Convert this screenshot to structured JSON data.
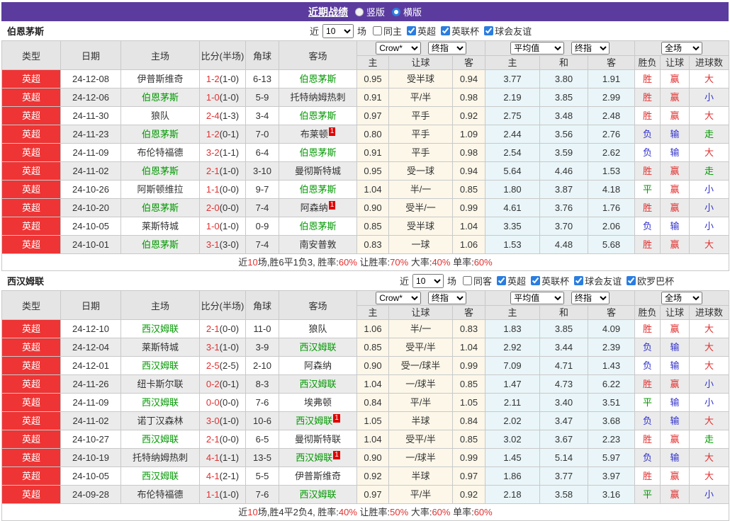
{
  "header": {
    "title": "近期战绩",
    "radio_vertical": "竖版",
    "radio_horizontal": "横版",
    "vertical_checked": false,
    "horizontal_checked": true
  },
  "labels": {
    "near": "近",
    "count": "10",
    "games": "场"
  },
  "selects": {
    "book": "Crow*",
    "final": "终指",
    "avg": "平均值",
    "full": "全场"
  },
  "columns": {
    "type": "类型",
    "date": "日期",
    "home": "主场",
    "score": "比分(半场)",
    "corner": "角球",
    "away": "客场",
    "sub": [
      "主",
      "让球",
      "客",
      "主",
      "和",
      "客",
      "胜负",
      "让球",
      "进球数"
    ]
  },
  "colors": {
    "topbar_purple": "#5b3c9e",
    "league_red": "#ee3434",
    "win_red": "#e23030",
    "lose_blue": "#3232cd",
    "draw_green": "#009900",
    "team_green": "#009900",
    "odds_bg": "#fcf7e9",
    "avg_bg": "#e9f5f9",
    "alt_row": "#ebebeb"
  },
  "sections": [
    {
      "team": "伯恩茅斯",
      "filters": [
        {
          "label": "同主",
          "checked": false
        },
        {
          "label": "英超",
          "checked": true
        },
        {
          "label": "英联杯",
          "checked": true
        },
        {
          "label": "球会友谊",
          "checked": true
        }
      ],
      "rows": [
        {
          "league": "英超",
          "date": "24-12-08",
          "home": "伊普斯维奇",
          "home_self": false,
          "home_badge": "",
          "score": "1-2",
          "half": "(1-0)",
          "corners": "6-13",
          "away": "伯恩茅斯",
          "away_self": true,
          "away_badge": "",
          "odds_home": "0.95",
          "handicap": "受半球",
          "odds_away": "0.94",
          "avg_home": "3.77",
          "avg_draw": "3.80",
          "avg_away": "1.91",
          "result": "胜",
          "result_c": "w",
          "let": "赢",
          "let_c": "w",
          "goals": "大",
          "goals_c": "w"
        },
        {
          "league": "英超",
          "date": "24-12-06",
          "home": "伯恩茅斯",
          "home_self": true,
          "home_badge": "",
          "score": "1-0",
          "half": "(1-0)",
          "corners": "5-9",
          "away": "托特纳姆热刺",
          "away_self": false,
          "away_badge": "",
          "odds_home": "0.91",
          "handicap": "平/半",
          "odds_away": "0.98",
          "avg_home": "2.19",
          "avg_draw": "3.85",
          "avg_away": "2.99",
          "result": "胜",
          "result_c": "w",
          "let": "赢",
          "let_c": "w",
          "goals": "小",
          "goals_c": "l"
        },
        {
          "league": "英超",
          "date": "24-11-30",
          "home": "狼队",
          "home_self": false,
          "home_badge": "",
          "score": "2-4",
          "half": "(1-3)",
          "corners": "3-4",
          "away": "伯恩茅斯",
          "away_self": true,
          "away_badge": "",
          "odds_home": "0.97",
          "handicap": "平手",
          "odds_away": "0.92",
          "avg_home": "2.75",
          "avg_draw": "3.48",
          "avg_away": "2.48",
          "result": "胜",
          "result_c": "w",
          "let": "赢",
          "let_c": "w",
          "goals": "大",
          "goals_c": "w"
        },
        {
          "league": "英超",
          "date": "24-11-23",
          "home": "伯恩茅斯",
          "home_self": true,
          "home_badge": "",
          "score": "1-2",
          "half": "(0-1)",
          "corners": "7-0",
          "away": "布莱顿",
          "away_self": false,
          "away_badge": "1",
          "odds_home": "0.80",
          "handicap": "平手",
          "odds_away": "1.09",
          "avg_home": "2.44",
          "avg_draw": "3.56",
          "avg_away": "2.76",
          "result": "负",
          "result_c": "l",
          "let": "输",
          "let_c": "l",
          "goals": "走",
          "goals_c": "d"
        },
        {
          "league": "英超",
          "date": "24-11-09",
          "home": "布伦特福德",
          "home_self": false,
          "home_badge": "",
          "score": "3-2",
          "half": "(1-1)",
          "corners": "6-4",
          "away": "伯恩茅斯",
          "away_self": true,
          "away_badge": "",
          "odds_home": "0.91",
          "handicap": "平手",
          "odds_away": "0.98",
          "avg_home": "2.54",
          "avg_draw": "3.59",
          "avg_away": "2.62",
          "result": "负",
          "result_c": "l",
          "let": "输",
          "let_c": "l",
          "goals": "大",
          "goals_c": "w"
        },
        {
          "league": "英超",
          "date": "24-11-02",
          "home": "伯恩茅斯",
          "home_self": true,
          "home_badge": "",
          "score": "2-1",
          "half": "(1-0)",
          "corners": "3-10",
          "away": "曼彻斯特城",
          "away_self": false,
          "away_badge": "",
          "odds_home": "0.95",
          "handicap": "受一球",
          "odds_away": "0.94",
          "avg_home": "5.64",
          "avg_draw": "4.46",
          "avg_away": "1.53",
          "result": "胜",
          "result_c": "w",
          "let": "赢",
          "let_c": "w",
          "goals": "走",
          "goals_c": "d"
        },
        {
          "league": "英超",
          "date": "24-10-26",
          "home": "阿斯顿维拉",
          "home_self": false,
          "home_badge": "",
          "score": "1-1",
          "half": "(0-0)",
          "corners": "9-7",
          "away": "伯恩茅斯",
          "away_self": true,
          "away_badge": "",
          "odds_home": "1.04",
          "handicap": "半/一",
          "odds_away": "0.85",
          "avg_home": "1.80",
          "avg_draw": "3.87",
          "avg_away": "4.18",
          "result": "平",
          "result_c": "d",
          "let": "赢",
          "let_c": "w",
          "goals": "小",
          "goals_c": "l"
        },
        {
          "league": "英超",
          "date": "24-10-20",
          "home": "伯恩茅斯",
          "home_self": true,
          "home_badge": "",
          "score": "2-0",
          "half": "(0-0)",
          "corners": "7-4",
          "away": "阿森纳",
          "away_self": false,
          "away_badge": "1",
          "odds_home": "0.90",
          "handicap": "受半/一",
          "odds_away": "0.99",
          "avg_home": "4.61",
          "avg_draw": "3.76",
          "avg_away": "1.76",
          "result": "胜",
          "result_c": "w",
          "let": "赢",
          "let_c": "w",
          "goals": "小",
          "goals_c": "l"
        },
        {
          "league": "英超",
          "date": "24-10-05",
          "home": "莱斯特城",
          "home_self": false,
          "home_badge": "",
          "score": "1-0",
          "half": "(1-0)",
          "corners": "0-9",
          "away": "伯恩茅斯",
          "away_self": true,
          "away_badge": "",
          "odds_home": "0.85",
          "handicap": "受半球",
          "odds_away": "1.04",
          "avg_home": "3.35",
          "avg_draw": "3.70",
          "avg_away": "2.06",
          "result": "负",
          "result_c": "l",
          "let": "输",
          "let_c": "l",
          "goals": "小",
          "goals_c": "l"
        },
        {
          "league": "英超",
          "date": "24-10-01",
          "home": "伯恩茅斯",
          "home_self": true,
          "home_badge": "",
          "score": "3-1",
          "half": "(3-0)",
          "corners": "7-4",
          "away": "南安普敦",
          "away_self": false,
          "away_badge": "",
          "odds_home": "0.83",
          "handicap": "一球",
          "odds_away": "1.06",
          "avg_home": "1.53",
          "avg_draw": "4.48",
          "avg_away": "5.68",
          "result": "胜",
          "result_c": "w",
          "let": "赢",
          "let_c": "w",
          "goals": "大",
          "goals_c": "w"
        }
      ],
      "summary": [
        {
          "t": "近"
        },
        {
          "t": "10",
          "r": true
        },
        {
          "t": "场,胜6平1负3, 胜率:"
        },
        {
          "t": "60%",
          "r": true
        },
        {
          "t": " 让胜率:"
        },
        {
          "t": "70%",
          "r": true
        },
        {
          "t": " 大率:"
        },
        {
          "t": "40%",
          "r": true
        },
        {
          "t": " 单率:"
        },
        {
          "t": "60%",
          "r": true
        }
      ]
    },
    {
      "team": "西汉姆联",
      "filters": [
        {
          "label": "同客",
          "checked": false
        },
        {
          "label": "英超",
          "checked": true
        },
        {
          "label": "英联杯",
          "checked": true
        },
        {
          "label": "球会友谊",
          "checked": true
        },
        {
          "label": "欧罗巴杯",
          "checked": true
        }
      ],
      "rows": [
        {
          "league": "英超",
          "date": "24-12-10",
          "home": "西汉姆联",
          "home_self": true,
          "home_badge": "",
          "score": "2-1",
          "half": "(0-0)",
          "corners": "11-0",
          "away": "狼队",
          "away_self": false,
          "away_badge": "",
          "odds_home": "1.06",
          "handicap": "半/一",
          "odds_away": "0.83",
          "avg_home": "1.83",
          "avg_draw": "3.85",
          "avg_away": "4.09",
          "result": "胜",
          "result_c": "w",
          "let": "赢",
          "let_c": "w",
          "goals": "大",
          "goals_c": "w"
        },
        {
          "league": "英超",
          "date": "24-12-04",
          "home": "莱斯特城",
          "home_self": false,
          "home_badge": "",
          "score": "3-1",
          "half": "(1-0)",
          "corners": "3-9",
          "away": "西汉姆联",
          "away_self": true,
          "away_badge": "",
          "odds_home": "0.85",
          "handicap": "受平/半",
          "odds_away": "1.04",
          "avg_home": "2.92",
          "avg_draw": "3.44",
          "avg_away": "2.39",
          "result": "负",
          "result_c": "l",
          "let": "输",
          "let_c": "l",
          "goals": "大",
          "goals_c": "w"
        },
        {
          "league": "英超",
          "date": "24-12-01",
          "home": "西汉姆联",
          "home_self": true,
          "home_badge": "",
          "score": "2-5",
          "half": "(2-5)",
          "corners": "2-10",
          "away": "阿森纳",
          "away_self": false,
          "away_badge": "",
          "odds_home": "0.90",
          "handicap": "受一/球半",
          "odds_away": "0.99",
          "avg_home": "7.09",
          "avg_draw": "4.71",
          "avg_away": "1.43",
          "result": "负",
          "result_c": "l",
          "let": "输",
          "let_c": "l",
          "goals": "大",
          "goals_c": "w"
        },
        {
          "league": "英超",
          "date": "24-11-26",
          "home": "纽卡斯尔联",
          "home_self": false,
          "home_badge": "",
          "score": "0-2",
          "half": "(0-1)",
          "corners": "8-3",
          "away": "西汉姆联",
          "away_self": true,
          "away_badge": "",
          "odds_home": "1.04",
          "handicap": "一/球半",
          "odds_away": "0.85",
          "avg_home": "1.47",
          "avg_draw": "4.73",
          "avg_away": "6.22",
          "result": "胜",
          "result_c": "w",
          "let": "赢",
          "let_c": "w",
          "goals": "小",
          "goals_c": "l"
        },
        {
          "league": "英超",
          "date": "24-11-09",
          "home": "西汉姆联",
          "home_self": true,
          "home_badge": "",
          "score": "0-0",
          "half": "(0-0)",
          "corners": "7-6",
          "away": "埃弗顿",
          "away_self": false,
          "away_badge": "",
          "odds_home": "0.84",
          "handicap": "平/半",
          "odds_away": "1.05",
          "avg_home": "2.11",
          "avg_draw": "3.40",
          "avg_away": "3.51",
          "result": "平",
          "result_c": "d",
          "let": "输",
          "let_c": "l",
          "goals": "小",
          "goals_c": "l"
        },
        {
          "league": "英超",
          "date": "24-11-02",
          "home": "诺丁汉森林",
          "home_self": false,
          "home_badge": "",
          "score": "3-0",
          "half": "(1-0)",
          "corners": "10-6",
          "away": "西汉姆联",
          "away_self": true,
          "away_badge": "1",
          "odds_home": "1.05",
          "handicap": "半球",
          "odds_away": "0.84",
          "avg_home": "2.02",
          "avg_draw": "3.47",
          "avg_away": "3.68",
          "result": "负",
          "result_c": "l",
          "let": "输",
          "let_c": "l",
          "goals": "大",
          "goals_c": "w"
        },
        {
          "league": "英超",
          "date": "24-10-27",
          "home": "西汉姆联",
          "home_self": true,
          "home_badge": "",
          "score": "2-1",
          "half": "(0-0)",
          "corners": "6-5",
          "away": "曼彻斯特联",
          "away_self": false,
          "away_badge": "",
          "odds_home": "1.04",
          "handicap": "受平/半",
          "odds_away": "0.85",
          "avg_home": "3.02",
          "avg_draw": "3.67",
          "avg_away": "2.23",
          "result": "胜",
          "result_c": "w",
          "let": "赢",
          "let_c": "w",
          "goals": "走",
          "goals_c": "d"
        },
        {
          "league": "英超",
          "date": "24-10-19",
          "home": "托特纳姆热刺",
          "home_self": false,
          "home_badge": "",
          "score": "4-1",
          "half": "(1-1)",
          "corners": "13-5",
          "away": "西汉姆联",
          "away_self": true,
          "away_badge": "1",
          "odds_home": "0.90",
          "handicap": "一/球半",
          "odds_away": "0.99",
          "avg_home": "1.45",
          "avg_draw": "5.14",
          "avg_away": "5.97",
          "result": "负",
          "result_c": "l",
          "let": "输",
          "let_c": "l",
          "goals": "大",
          "goals_c": "w"
        },
        {
          "league": "英超",
          "date": "24-10-05",
          "home": "西汉姆联",
          "home_self": true,
          "home_badge": "",
          "score": "4-1",
          "half": "(2-1)",
          "corners": "5-5",
          "away": "伊普斯维奇",
          "away_self": false,
          "away_badge": "",
          "odds_home": "0.92",
          "handicap": "半球",
          "odds_away": "0.97",
          "avg_home": "1.86",
          "avg_draw": "3.77",
          "avg_away": "3.97",
          "result": "胜",
          "result_c": "w",
          "let": "赢",
          "let_c": "w",
          "goals": "大",
          "goals_c": "w"
        },
        {
          "league": "英超",
          "date": "24-09-28",
          "home": "布伦特福德",
          "home_self": false,
          "home_badge": "",
          "score": "1-1",
          "half": "(1-0)",
          "corners": "7-6",
          "away": "西汉姆联",
          "away_self": true,
          "away_badge": "",
          "odds_home": "0.97",
          "handicap": "平/半",
          "odds_away": "0.92",
          "avg_home": "2.18",
          "avg_draw": "3.58",
          "avg_away": "3.16",
          "result": "平",
          "result_c": "d",
          "let": "赢",
          "let_c": "w",
          "goals": "小",
          "goals_c": "l"
        }
      ],
      "summary": [
        {
          "t": "近"
        },
        {
          "t": "10",
          "r": true
        },
        {
          "t": "场,胜4平2负4, 胜率:"
        },
        {
          "t": "40%",
          "r": true
        },
        {
          "t": " 让胜率:"
        },
        {
          "t": "50%",
          "r": true
        },
        {
          "t": " 大率:"
        },
        {
          "t": "60%",
          "r": true
        },
        {
          "t": " 单率:"
        },
        {
          "t": "60%",
          "r": true
        }
      ]
    }
  ]
}
